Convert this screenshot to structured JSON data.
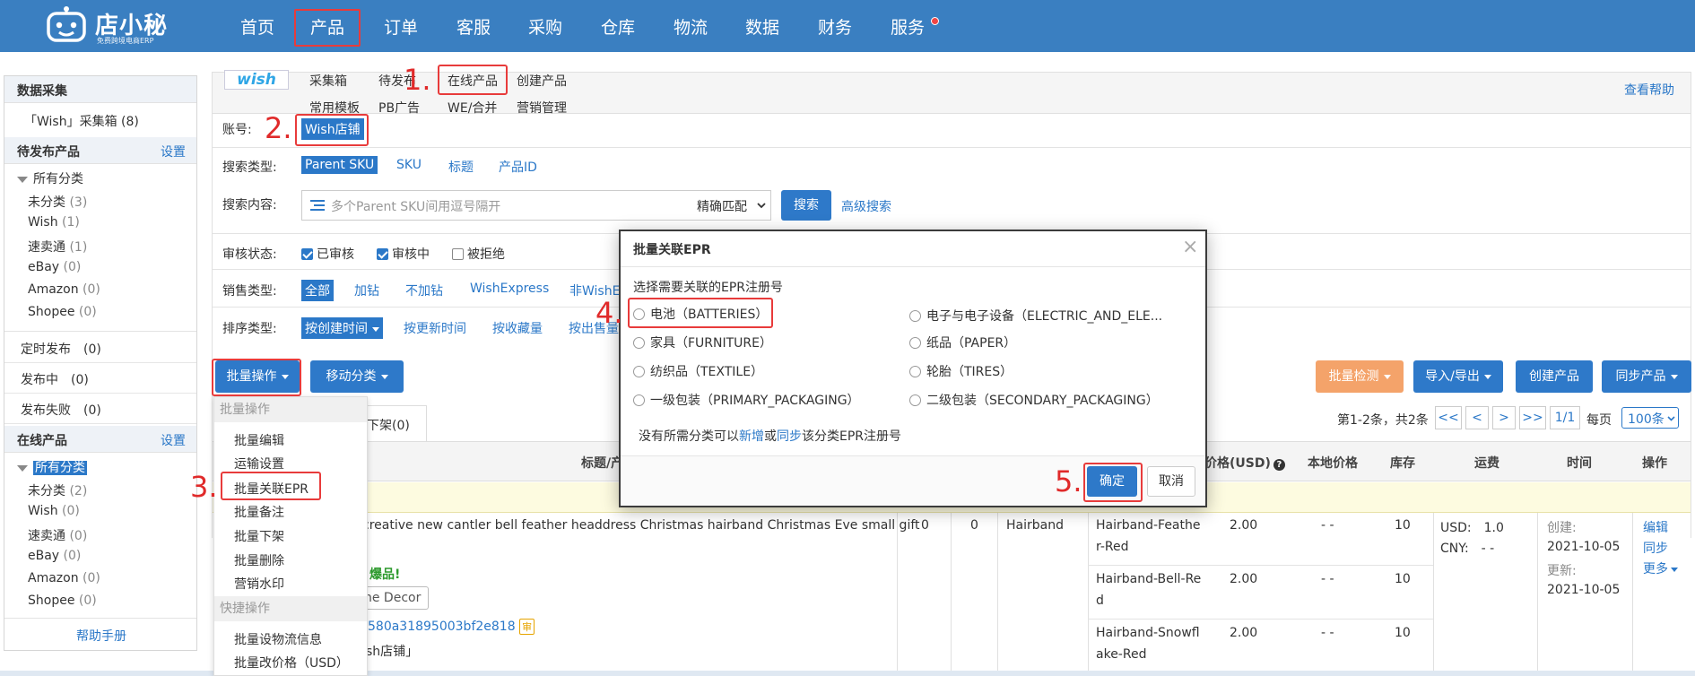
{
  "brand": {
    "name": "店小秘",
    "tagline": "免费跨境电商ERP"
  },
  "nav": {
    "items": [
      "首页",
      "产品",
      "订单",
      "客服",
      "采购",
      "仓库",
      "物流",
      "数据",
      "财务",
      "服务"
    ],
    "active": "产品"
  },
  "sidebar": {
    "collect_title": "数据采集",
    "collect_box": "「Wish」采集箱 (8)",
    "pending_title": "待发布产品",
    "pending_setting": "设置",
    "all_category": "所有分类",
    "pending_items": [
      {
        "label": "未分类",
        "count": "(3)"
      },
      {
        "label": "Wish",
        "count": "(1)"
      },
      {
        "label": "速卖通",
        "count": "(1)"
      },
      {
        "label": "eBay",
        "count": "(0)"
      },
      {
        "label": "Amazon",
        "count": "(0)"
      },
      {
        "label": "Shopee",
        "count": "(0)"
      }
    ],
    "timed_publish": "定时发布　(0)",
    "publishing": "发布中　(0)",
    "publish_failed": "发布失败　(0)",
    "online_title": "在线产品",
    "online_setting": "设置",
    "online_all_category": "所有分类",
    "online_items": [
      {
        "label": "未分类",
        "count": "(2)"
      },
      {
        "label": "Wish",
        "count": "(0)"
      },
      {
        "label": "速卖通",
        "count": "(0)"
      },
      {
        "label": "eBay",
        "count": "(0)"
      },
      {
        "label": "Amazon",
        "count": "(0)"
      },
      {
        "label": "Shopee",
        "count": "(0)"
      }
    ],
    "help": "帮助手册"
  },
  "subnav": {
    "platform_logo": "wish",
    "row1": [
      "采集箱",
      "待发布",
      "在线产品",
      "创建产品"
    ],
    "row2": [
      "常用模板",
      "PB广告",
      "WE/合并",
      "营销管理"
    ],
    "help_link": "查看帮助"
  },
  "filters": {
    "account_label": "账号:",
    "account_value": "Wish店铺",
    "search_type_label": "搜索类型:",
    "search_types": [
      "Parent SKU",
      "SKU",
      "标题",
      "产品ID"
    ],
    "search_content_label": "搜索内容:",
    "search_placeholder": "多个Parent SKU间用逗号隔开",
    "match_mode": "精确匹配",
    "search_button": "搜索",
    "advanced_search": "高级搜索",
    "review_label": "审核状态:",
    "review_options": [
      {
        "label": "已审核",
        "checked": true
      },
      {
        "label": "审核中",
        "checked": true
      },
      {
        "label": "被拒绝",
        "checked": false
      }
    ],
    "sales_label": "销售类型:",
    "sales_types": [
      "全部",
      "加钻",
      "不加钻",
      "WishExpress",
      "非WishE"
    ],
    "sort_label": "排序类型:",
    "sort_types": [
      "按创建时间",
      "按更新时间",
      "按收藏量",
      "按出售量"
    ]
  },
  "toolbar": {
    "bulk_ops": "批量操作",
    "move_category": "移动分类",
    "bulk_check": "批量检测",
    "import_export": "导入/导出",
    "create_product": "创建产品",
    "sync_product": "同步产品",
    "tab_offline": "下架(0)",
    "pagination_info": "第1-2条，共2条",
    "page_first": "<<",
    "page_prev": "<",
    "page_next": ">",
    "page_last": ">>",
    "page_current": "1/1",
    "per_page_label": "每页",
    "per_page_value": "100条"
  },
  "bulk_menu": {
    "group1_title": "批量操作",
    "group1": [
      "批量编辑",
      "运输设置",
      "批量关联EPR",
      "批量备注",
      "批量下架",
      "批量删除",
      "营销水印"
    ],
    "group2_title": "快捷操作",
    "group2": [
      "批量设物流信息",
      "批量改价格（USD）"
    ]
  },
  "table": {
    "headers": [
      "标题/产",
      "价格(USD)",
      "本地价格",
      "库存",
      "运费",
      "时间",
      "操作"
    ],
    "product_title": "creative new cantler bell feather headdress Christmas hairband Christmas Eve small gift",
    "col_a": "0",
    "col_b": "0",
    "tag": "Hairband",
    "hot_tag": "爆品!",
    "category_tag": "ne Decor",
    "product_id": "580a31895003bf2e818",
    "review_badge": "审",
    "shop": "sh店铺」",
    "variants": [
      {
        "sku_l1": "Hairband-Feathe",
        "sku_l2": "r-Red",
        "price": "2.00",
        "local": "- -",
        "stock": "10"
      },
      {
        "sku_l1": "Hairband-Bell-Re",
        "sku_l2": "d",
        "price": "2.00",
        "local": "- -",
        "stock": "10"
      },
      {
        "sku_l1": "Hairband-Snowfl",
        "sku_l2": "ake-Red",
        "price": "2.00",
        "local": "- -",
        "stock": "10"
      }
    ],
    "shipping_usd": "USD:　1.0",
    "shipping_cny": "CNY:　- -",
    "created_label": "创建:",
    "created_date": "2021-10-05",
    "updated_label": "更新:",
    "updated_date": "2021-10-05",
    "actions": [
      "编辑",
      "同步",
      "更多"
    ]
  },
  "modal": {
    "title": "批量关联EPR",
    "close": "×",
    "instruction": "选择需要关联的EPR注册号",
    "options": [
      "电池（BATTERIES）",
      "电子与电子设备（ELECTRIC_AND_ELE...",
      "家具（FURNITURE）",
      "纸品（PAPER）",
      "纺织品（TEXTILE）",
      "轮胎（TIRES）",
      "一级包装（PRIMARY_PACKAGING）",
      "二级包装（SECONDARY_PACKAGING）"
    ],
    "note_prefix": "没有所需分类可以",
    "note_add": "新增",
    "note_or": "或",
    "note_sync": "同步",
    "note_suffix": "该分类EPR注册号",
    "confirm": "确定",
    "cancel": "取消"
  },
  "steps": [
    "1.",
    "2.",
    "3.",
    "4.",
    "5."
  ]
}
